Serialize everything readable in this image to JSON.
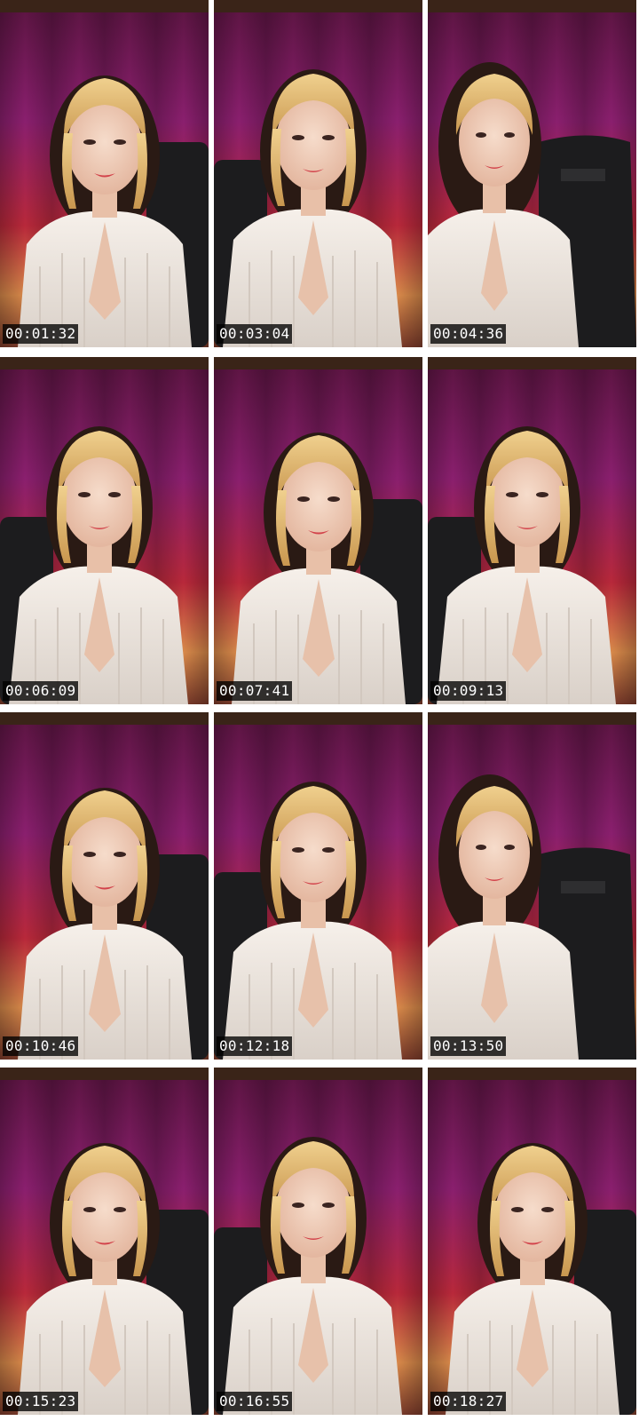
{
  "frames": [
    {
      "timestamp": "00:01:32"
    },
    {
      "timestamp": "00:03:04"
    },
    {
      "timestamp": "00:04:36"
    },
    {
      "timestamp": "00:06:09"
    },
    {
      "timestamp": "00:07:41"
    },
    {
      "timestamp": "00:09:13"
    },
    {
      "timestamp": "00:10:46"
    },
    {
      "timestamp": "00:12:18"
    },
    {
      "timestamp": "00:13:50"
    },
    {
      "timestamp": "00:15:23"
    },
    {
      "timestamp": "00:16:55"
    },
    {
      "timestamp": "00:18:27"
    }
  ],
  "colors": {
    "curtain_purple": "#8a1f6e",
    "curtain_red": "#b8283a",
    "curtain_orange": "#d8894a",
    "hair_blonde": "#e8c27a",
    "hair_dark": "#2a1a14",
    "skin": "#f0cdb8",
    "top_white": "#f3ece6",
    "chair_black": "#1c1c1e",
    "timestamp_bg": "#000000"
  }
}
